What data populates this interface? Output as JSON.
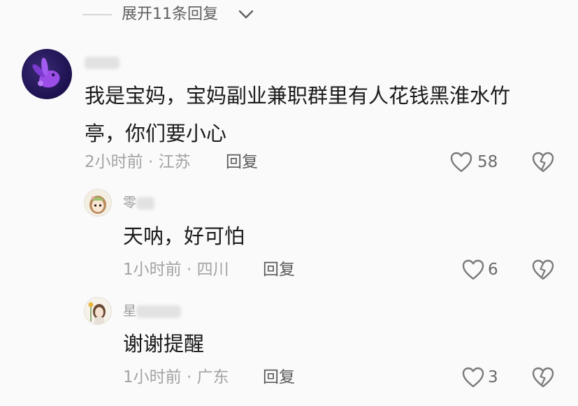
{
  "thread": {
    "expand_label": "展开11条回复"
  },
  "comments": [
    {
      "username": "",
      "text_lines": [
        "我是宝妈，宝妈副业兼职群里有人花钱黑淮水竹",
        "亭，你们要小心"
      ],
      "time": "2小时前 · 江苏",
      "reply_label": "回复",
      "likes": "58"
    },
    {
      "username": "零",
      "text": "天呐，好可怕",
      "time": "1小时前 · 四川",
      "reply_label": "回复",
      "likes": "6"
    },
    {
      "username": "星",
      "text": "谢谢提醒",
      "time": "1小时前 · 广东",
      "reply_label": "回复",
      "likes": "3"
    }
  ],
  "colors": {
    "background": "#fafafa",
    "text_primary": "#1a1a1a",
    "text_secondary": "#a3a3a3",
    "icon_stroke": "#7a7a7a"
  },
  "icons": [
    "chevron-down-icon",
    "heart-icon",
    "dislike-heart-icon"
  ]
}
